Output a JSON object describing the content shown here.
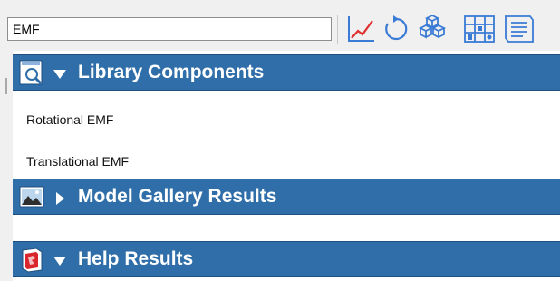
{
  "search": {
    "value": "EMF"
  },
  "toolbar": {
    "icons": [
      "plot-icon",
      "rotate-icon",
      "components-icon",
      "grid-icon",
      "document-icon"
    ]
  },
  "sections": [
    {
      "title": "Library Components",
      "expanded": true,
      "items": [
        "Rotational EMF",
        "Translational EMF"
      ]
    },
    {
      "title": "Model Gallery Results",
      "expanded": false,
      "items": []
    },
    {
      "title": "Help Results",
      "expanded": true,
      "items": []
    }
  ],
  "colors": {
    "header_bg": "#2f6ea8",
    "header_text": "#ffffff",
    "panel_bg": "#ffffff",
    "toolbar_bg": "#f0f0f0"
  }
}
